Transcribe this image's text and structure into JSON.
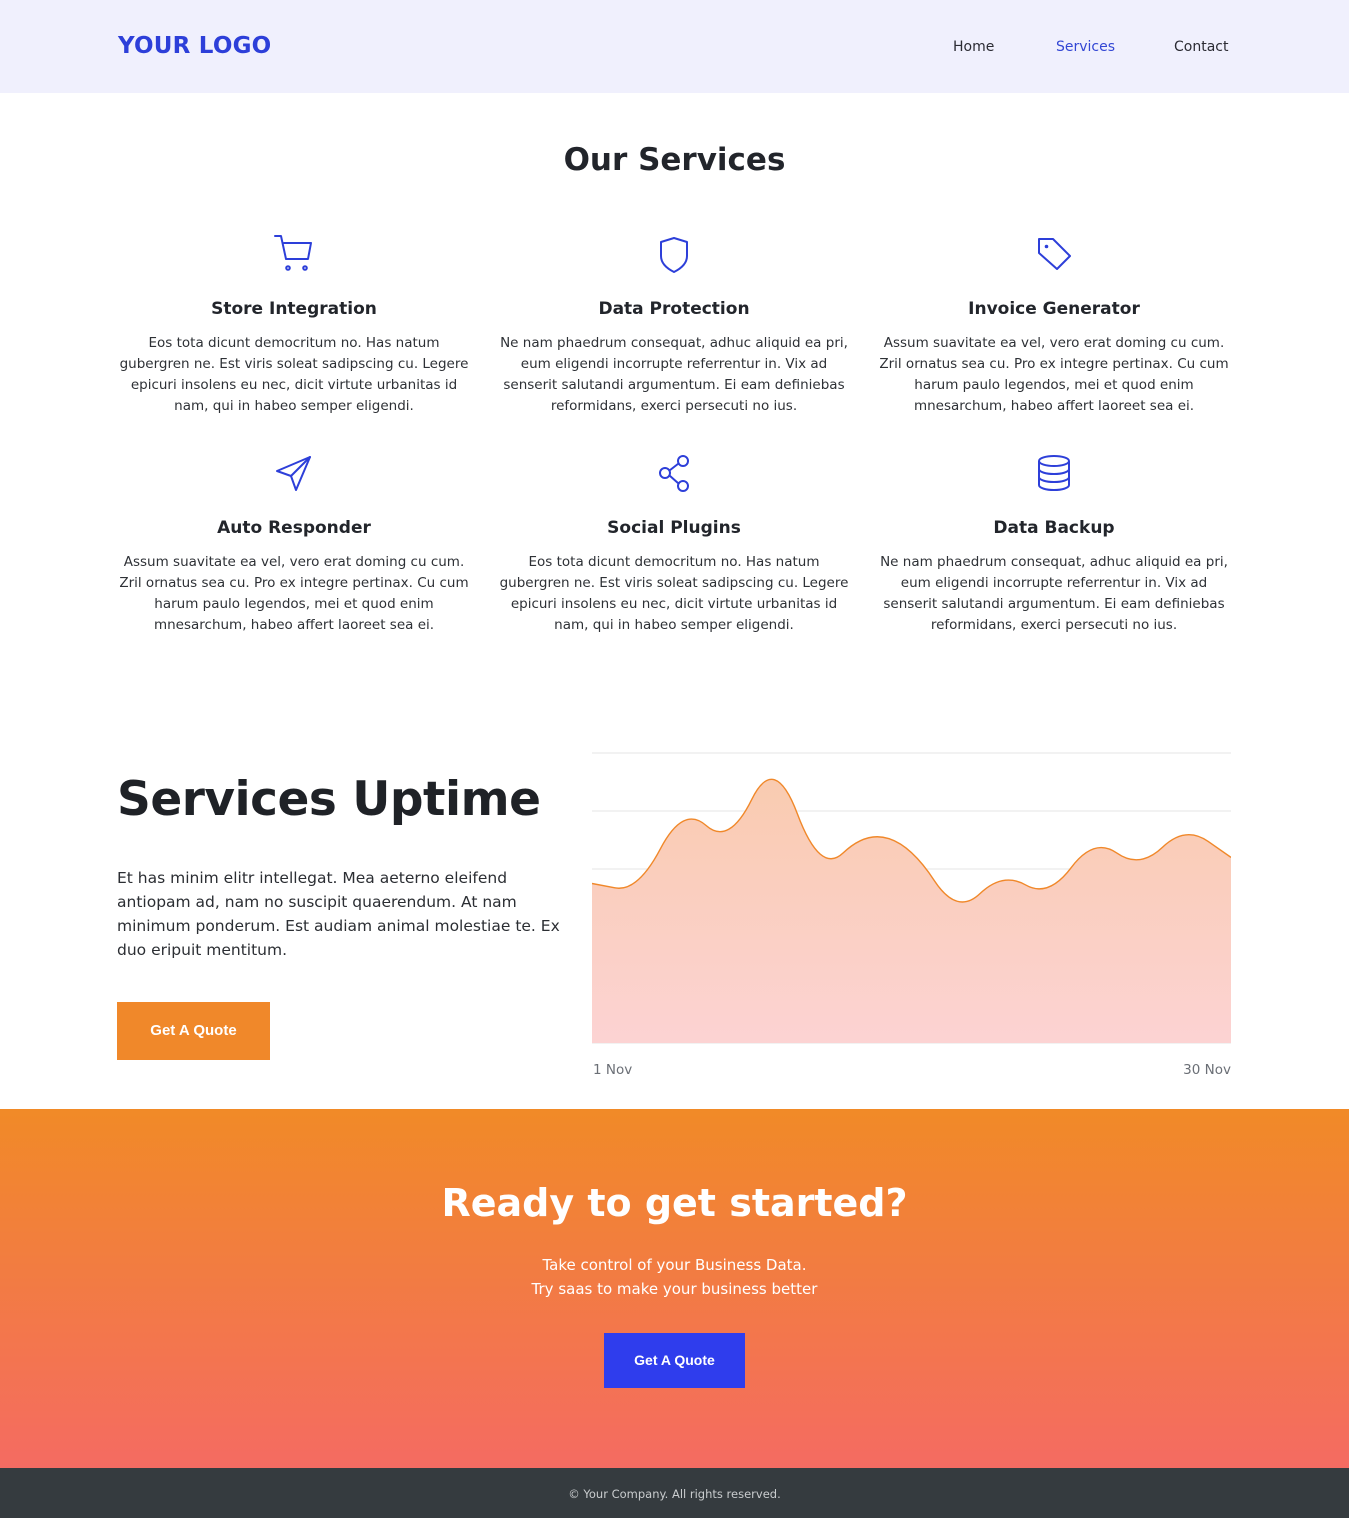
{
  "header": {
    "logo": "YOUR LOGO",
    "nav": [
      {
        "label": "Home",
        "active": false
      },
      {
        "label": "Services",
        "active": true
      },
      {
        "label": "Contact",
        "active": false
      }
    ]
  },
  "services": {
    "title": "Our Services",
    "items": [
      {
        "icon": "cart-icon",
        "title": "Store Integration",
        "text": "Eos tota dicunt democritum no. Has natum gubergren ne. Est viris soleat sadipscing cu. Legere epicuri insolens eu nec, dicit virtute urbanitas id nam, qui in habeo semper eligendi."
      },
      {
        "icon": "shield-icon",
        "title": "Data Protection",
        "text": "Ne nam phaedrum consequat, adhuc aliquid ea pri, eum eligendi incorrupte referrentur in. Vix ad senserit salutandi argumentum. Ei eam definiebas reformidans, exerci persecuti no ius."
      },
      {
        "icon": "tag-icon",
        "title": "Invoice Generator",
        "text": "Assum suavitate ea vel, vero erat doming cu cum. Zril ornatus sea cu. Pro ex integre pertinax. Cu cum harum paulo legendos, mei et quod enim mnesarchum, habeo affert laoreet sea ei."
      },
      {
        "icon": "paper-plane-icon",
        "title": "Auto Responder",
        "text": "Assum suavitate ea vel, vero erat doming cu cum. Zril ornatus sea cu. Pro ex integre pertinax. Cu cum harum paulo legendos, mei et quod enim mnesarchum, habeo affert laoreet sea ei."
      },
      {
        "icon": "share-icon",
        "title": "Social Plugins",
        "text": "Eos tota dicunt democritum no. Has natum gubergren ne. Est viris soleat sadipscing cu. Legere epicuri insolens eu nec, dicit virtute urbanitas id nam, qui in habeo semper eligendi."
      },
      {
        "icon": "database-icon",
        "title": "Data Backup",
        "text": "Ne nam phaedrum consequat, adhuc aliquid ea pri, eum eligendi incorrupte referrentur in. Vix ad senserit salutandi argumentum. Ei eam definiebas reformidans, exerci persecuti no ius."
      }
    ]
  },
  "uptime": {
    "title": "Services Uptime",
    "text": "Et has minim elitr intellegat. Mea aeterno eleifend antiopam ad, nam no suscipit quaerendum. At nam minimum ponderum. Est audiam animal molestiae te. Ex duo eripuit mentitum.",
    "button": "Get A Quote"
  },
  "chart_data": {
    "type": "area",
    "x_labels": [
      "1 Nov",
      "30 Nov"
    ],
    "values": [
      55,
      52,
      82,
      68,
      100,
      58,
      73,
      68,
      44,
      59,
      50,
      71,
      60,
      75,
      64
    ],
    "ylim": [
      0,
      100
    ],
    "grid": true,
    "line_color": "#f0882a",
    "fill_top_color": "#f9cbb0",
    "fill_bottom_color": "#fcd3d3"
  },
  "cta": {
    "title": "Ready to get started?",
    "line1": "Take control of your Business Data.",
    "line2": "Try saas to make your business better",
    "button": "Get A Quote"
  },
  "footer": {
    "text": "© Your Company. All rights reserved."
  },
  "colors": {
    "accent": "#2d3fd9",
    "orange": "#f0882a",
    "blue_button": "#2f3ded",
    "footer_bg": "#353b3f"
  }
}
